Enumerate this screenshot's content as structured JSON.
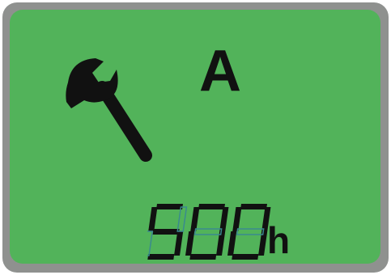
{
  "display": {
    "mode_letter": "A",
    "hours_value": "500",
    "unit": "h",
    "icon": "wrench-icon"
  },
  "colors": {
    "lcd_background": "#52b35a",
    "bezel": "#8f918f",
    "segment_on": "#111111",
    "segment_off": "#3a8a8f"
  }
}
